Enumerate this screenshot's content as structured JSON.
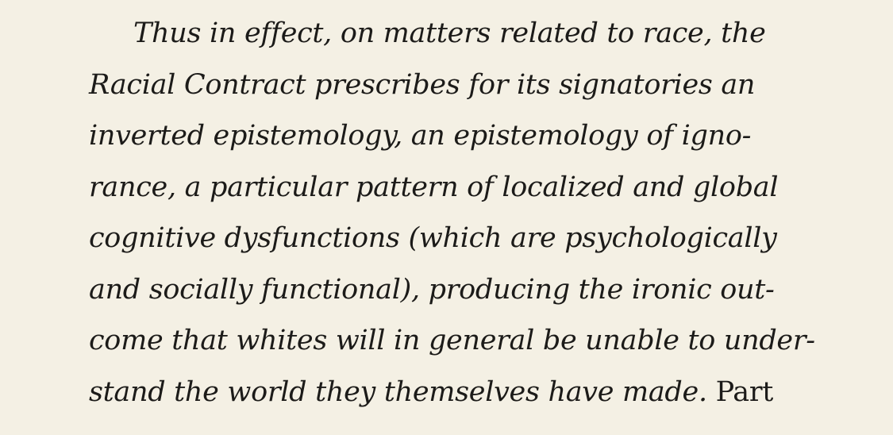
{
  "document": {
    "lines": [
      "Thus in effect, on matters related to race, the",
      "Racial Contract prescribes for its signatories an",
      "inverted epistemology, an epistemology of igno-",
      "rance, a particular pattern of localized and global",
      "cognitive dysfunctions (which are psychologically",
      "and socially functional), producing the ironic out-",
      "come that whites will in general be unable to under-",
      "stand the world they themselves have made."
    ],
    "trailing_word": "Part"
  }
}
